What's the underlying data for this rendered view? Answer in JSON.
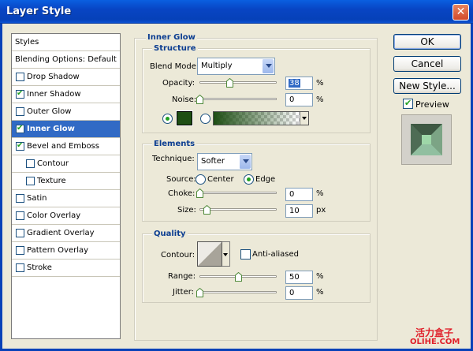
{
  "window": {
    "title": "Layer Style",
    "close_glyph": "✕"
  },
  "styles_panel": {
    "items": [
      {
        "label": "Styles",
        "checkbox": false
      },
      {
        "label": "Blending Options: Default",
        "checkbox": false
      },
      {
        "label": "Drop Shadow",
        "checkbox": true,
        "checked": false
      },
      {
        "label": "Inner Shadow",
        "checkbox": true,
        "checked": true
      },
      {
        "label": "Outer Glow",
        "checkbox": true,
        "checked": false
      },
      {
        "label": "Inner Glow",
        "checkbox": true,
        "checked": true,
        "selected": true
      },
      {
        "label": "Bevel and Emboss",
        "checkbox": true,
        "checked": true
      },
      {
        "label": "Contour",
        "checkbox": true,
        "checked": false,
        "indent": true
      },
      {
        "label": "Texture",
        "checkbox": true,
        "checked": false,
        "indent": true
      },
      {
        "label": "Satin",
        "checkbox": true,
        "checked": false
      },
      {
        "label": "Color Overlay",
        "checkbox": true,
        "checked": false
      },
      {
        "label": "Gradient Overlay",
        "checkbox": true,
        "checked": false
      },
      {
        "label": "Pattern Overlay",
        "checkbox": true,
        "checked": false
      },
      {
        "label": "Stroke",
        "checkbox": true,
        "checked": false
      }
    ]
  },
  "inner_glow": {
    "title": "Inner Glow",
    "structure": {
      "title": "Structure",
      "blend_mode_label": "Blend Mode:",
      "blend_mode_value": "Multiply",
      "opacity_label": "Opacity:",
      "opacity_value": "38",
      "opacity_unit": "%",
      "noise_label": "Noise:",
      "noise_value": "0",
      "noise_unit": "%",
      "glow_color": "#1E4E14",
      "mode": "solid-color"
    },
    "elements": {
      "title": "Elements",
      "technique_label": "Technique:",
      "technique_value": "Softer",
      "source_label": "Source:",
      "source_center": "Center",
      "source_edge": "Edge",
      "source_selected": "Edge",
      "choke_label": "Choke:",
      "choke_value": "0",
      "choke_unit": "%",
      "size_label": "Size:",
      "size_value": "10",
      "size_unit": "px"
    },
    "quality": {
      "title": "Quality",
      "contour_label": "Contour:",
      "anti_aliased_label": "Anti-aliased",
      "anti_aliased": false,
      "range_label": "Range:",
      "range_value": "50",
      "range_unit": "%",
      "jitter_label": "Jitter:",
      "jitter_value": "0",
      "jitter_unit": "%"
    }
  },
  "actions": {
    "ok": "OK",
    "cancel": "Cancel",
    "new_style": "New Style...",
    "preview_label": "Preview",
    "preview_checked": true
  },
  "watermark": {
    "line1": "活力盒子",
    "line2": "OLIHE.COM"
  }
}
